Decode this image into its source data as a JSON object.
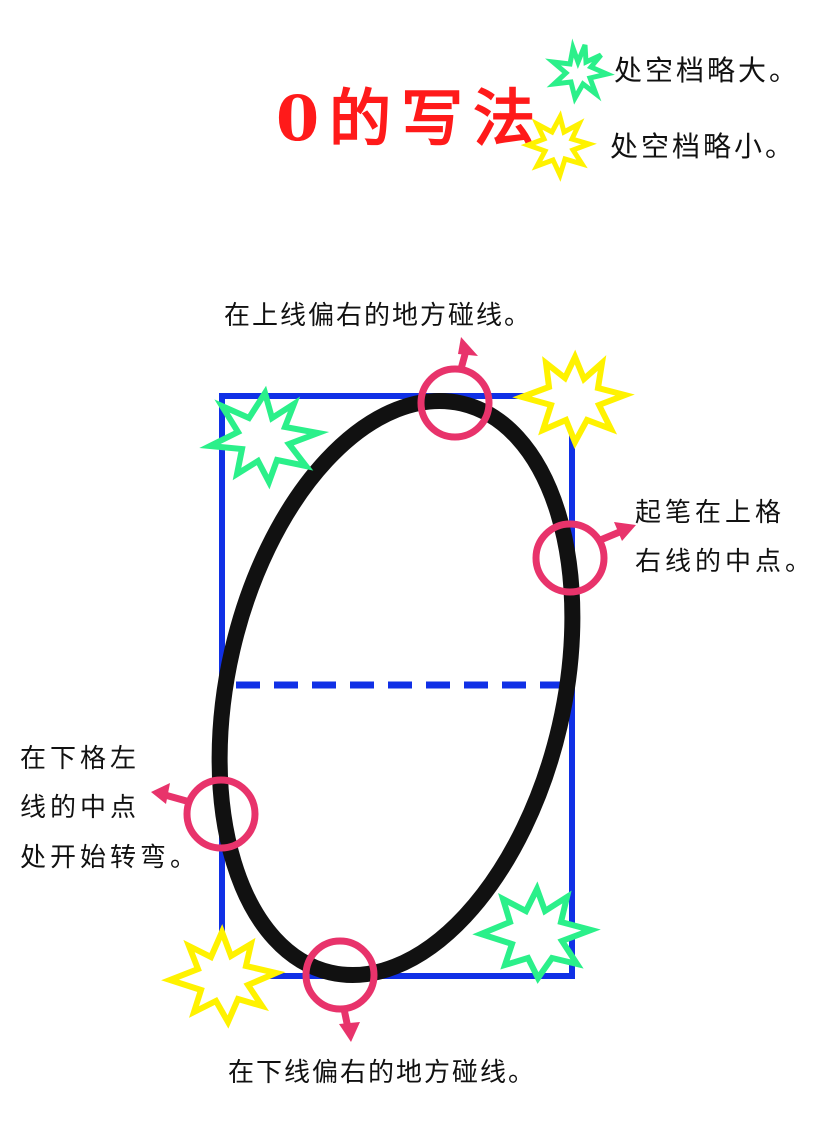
{
  "title": "0的写法",
  "legend": [
    {
      "text": "处空档略大。",
      "icon": "green-star-icon",
      "color": "#2bf08a"
    },
    {
      "text": "处空档略小。",
      "icon": "yellow-star-icon",
      "color": "#fff200"
    }
  ],
  "annotations": {
    "top": "在上线偏右的地方碰线。",
    "right_line1": "起笔在上格",
    "right_line2": "右线的中点。",
    "left_line1": "在下格左",
    "left_line2": "线的中点",
    "left_line3": "处开始转弯。",
    "bottom": "在下线偏右的地方碰线。"
  },
  "colors": {
    "title": "#ff1a1a",
    "grid": "#1030e6",
    "digit": "#111111",
    "marker": "#e8336b",
    "green_star": "#2bf08a",
    "yellow_star": "#fff200"
  }
}
